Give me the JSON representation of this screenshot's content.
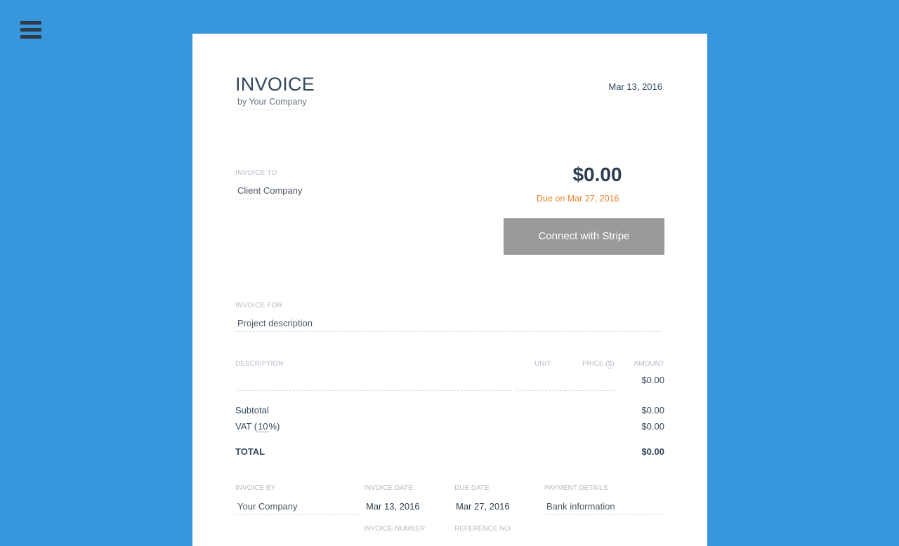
{
  "menu": {
    "icon": "hamburger-menu-icon"
  },
  "invoice": {
    "title": "INVOICE",
    "company_subtitle": "by Your Company",
    "date": "Mar 13, 2016",
    "invoice_to_label": "INVOICE TO",
    "client": "Client Company",
    "amount_due": "$0.00",
    "due_prefix": "Due on",
    "due_date": "Mar 27, 2016",
    "stripe_button": "Connect with Stripe",
    "invoice_for_label": "INVOICE FOR",
    "project_description": "Project description"
  },
  "table": {
    "headers": {
      "description": "DESCRIPTION",
      "unit": "UNIT",
      "price_prefix": "PRICE (",
      "price_currency": "$",
      "price_suffix": ")",
      "amount": "AMOUNT"
    },
    "row_amount": "$0.00"
  },
  "totals": {
    "subtotal_label": "Subtotal",
    "subtotal_value": "$0.00",
    "vat_prefix": "VAT (",
    "vat_rate": "10",
    "vat_suffix": "%)",
    "vat_value": "$0.00",
    "total_label": "TOTAL",
    "total_value": "$0.00"
  },
  "footer": {
    "invoice_by_label": "INVOICE BY",
    "invoice_by": "Your Company",
    "invoice_date_label": "INVOICE DATE",
    "invoice_date": "Mar 13, 2016",
    "due_date_label": "DUE DATE",
    "due_date": "Mar 27, 2016",
    "payment_details_label": "PAYMENT DETAILS",
    "payment_details": "Bank information",
    "invoice_number_label": "INVOICE NUMBER",
    "reference_no_label": "REFERENCE NO"
  },
  "colors": {
    "background": "#3897dc",
    "paper": "#ffffff",
    "accent_due": "#e5832a",
    "button": "#9a9a9a",
    "text_dark": "#2c3e50"
  }
}
